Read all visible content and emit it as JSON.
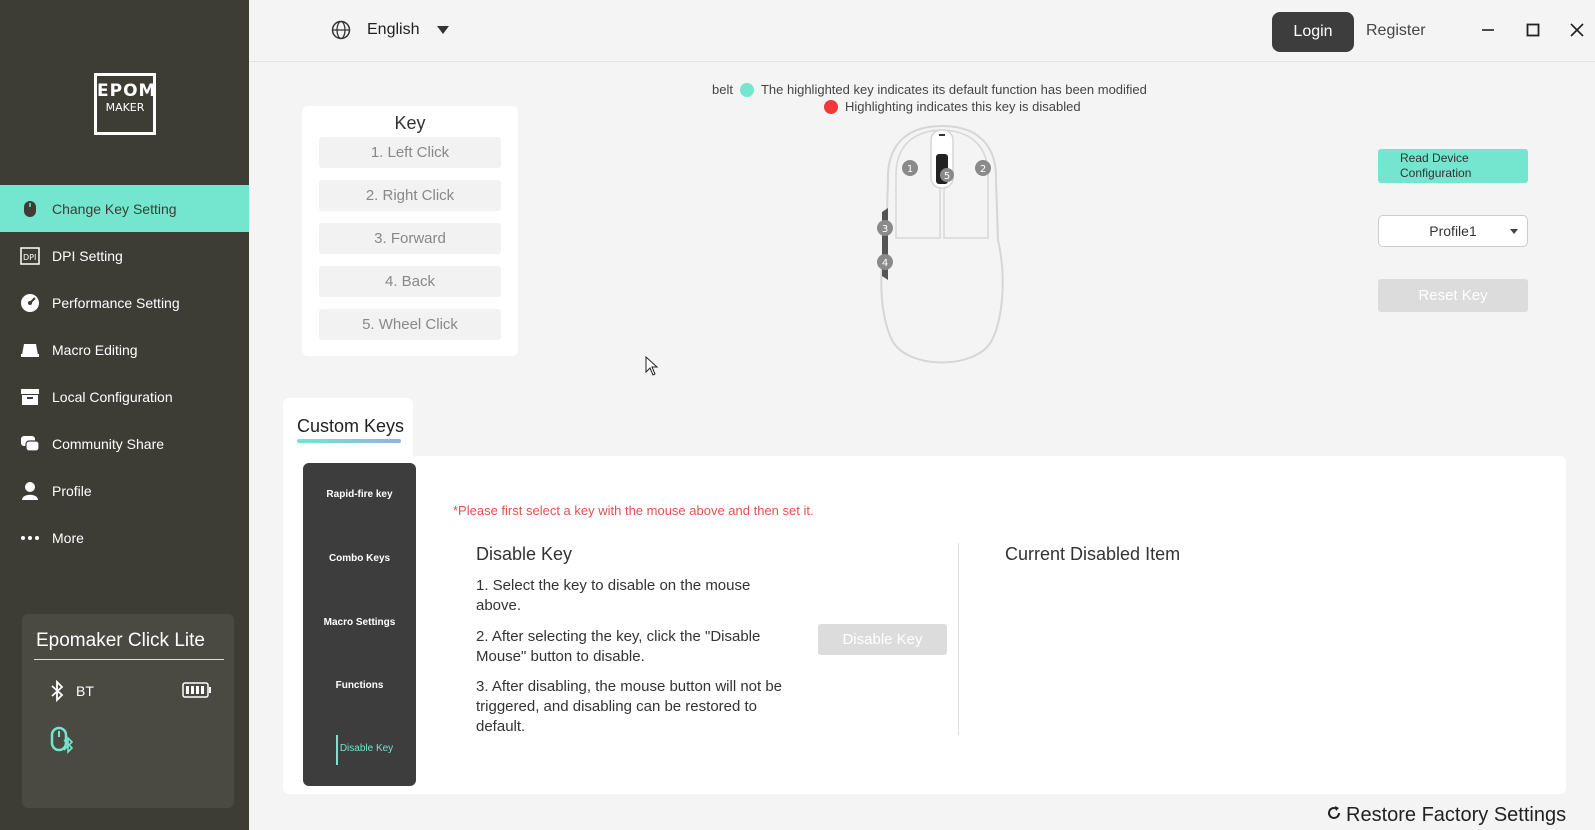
{
  "sidebar": {
    "logo_top": "EPOM",
    "logo_bottom": "MAKER",
    "items": [
      {
        "label": "Change Key Setting",
        "icon": "mouse-icon"
      },
      {
        "label": "DPI Setting",
        "icon": "dpi-icon"
      },
      {
        "label": "Performance Setting",
        "icon": "gauge-icon"
      },
      {
        "label": "Macro Editing",
        "icon": "keyboard-icon"
      },
      {
        "label": "Local Configuration",
        "icon": "archive-icon"
      },
      {
        "label": "Community Share",
        "icon": "chat-icon"
      },
      {
        "label": "Profile",
        "icon": "user-icon"
      },
      {
        "label": "More",
        "icon": "more-icon"
      }
    ],
    "device": {
      "name": "Epomaker Click Lite",
      "connection": "BT",
      "battery_level": 1.0
    }
  },
  "topbar": {
    "language": "English",
    "login": "Login",
    "register": "Register"
  },
  "legend": {
    "prefix": "belt",
    "modified": "The highlighted key indicates its default function has been modified",
    "disabled": "Highlighting indicates this key is disabled",
    "modified_color": "#74e5ce",
    "disabled_color": "#f03a3a"
  },
  "key_panel": {
    "title": "Key",
    "items": [
      "1. Left Click",
      "2. Right Click",
      "3. Forward",
      "4. Back",
      "5. Wheel Click"
    ]
  },
  "mouse_labels": [
    "1",
    "2",
    "3",
    "4",
    "5"
  ],
  "right_panel": {
    "read_device": "Read Device Configuration",
    "profile": "Profile1",
    "reset": "Reset Key"
  },
  "custom": {
    "tab": "Custom Keys",
    "side_tabs": [
      "Rapid-fire key",
      "Combo Keys",
      "Macro Settings",
      "Functions",
      "Disable Key"
    ],
    "active_tab": "Disable Key",
    "hint": "*Please first select a key with the mouse above and then set it.",
    "title": "Disable Key",
    "steps": [
      "1. Select the key to disable on the mouse above.",
      "2. After selecting the key, click the \"Disable Mouse\" button to disable.",
      "3. After disabling, the mouse button will not be triggered, and disabling can be restored to default."
    ],
    "disable_button": "Disable Key",
    "current_title": "Current Disabled Item"
  },
  "footer": {
    "restore": "Restore Factory Settings"
  },
  "colors": {
    "accent": "#74e5ce",
    "sidebar": "#3d3d35"
  }
}
